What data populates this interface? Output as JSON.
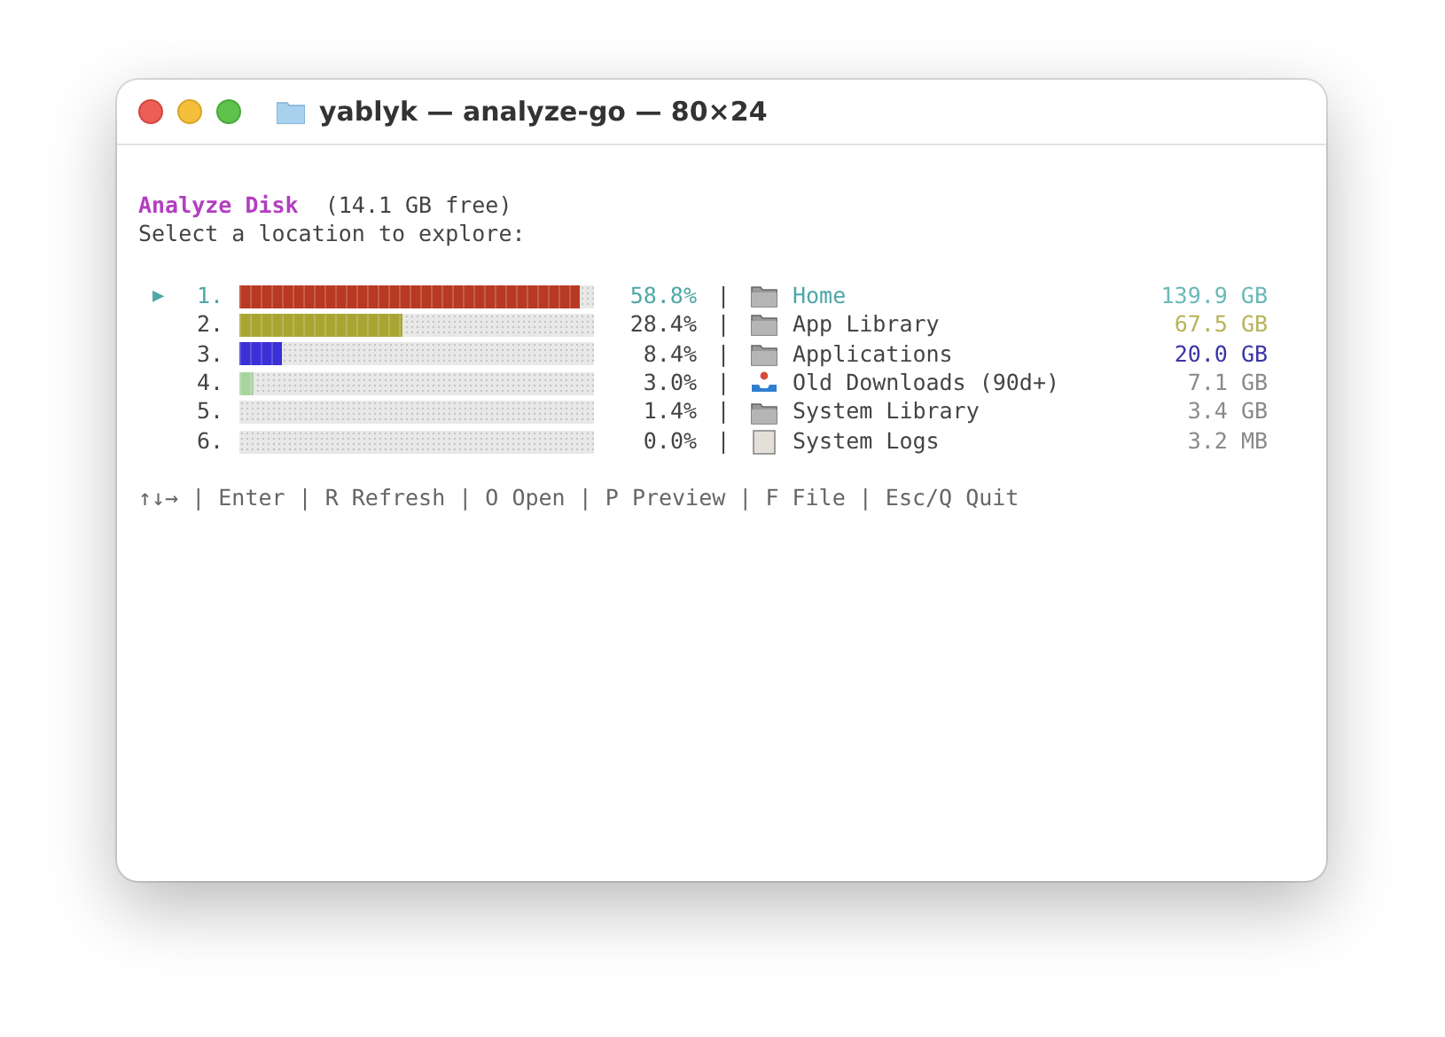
{
  "window": {
    "title": "yablyk — analyze-go — 80×24"
  },
  "header": {
    "title": "Analyze Disk",
    "free": "(14.1 GB free)",
    "prompt": "Select a location to explore:"
  },
  "pointer": "▶",
  "separator": "|",
  "rows": [
    {
      "number": "1.",
      "bar": {
        "level": 0.96,
        "color": "#b83a22"
      },
      "percent": "58.8%",
      "kind": "folder",
      "name": "Home",
      "size": {
        "text": "139.9 GB",
        "color": "#6bb8b8"
      },
      "selected": true
    },
    {
      "number": "2.",
      "bar": {
        "level": 0.46,
        "color": "#a8a533"
      },
      "percent": "28.4%",
      "kind": "folder",
      "name": "App Library",
      "size": {
        "text": "67.5 GB",
        "color": "#b8b35a"
      },
      "selected": false
    },
    {
      "number": "3.",
      "bar": {
        "level": 0.12,
        "color": "#3b2fd6"
      },
      "percent": "8.4%",
      "kind": "folder",
      "name": "Applications",
      "size": {
        "text": "20.0 GB",
        "color": "#3a34a8"
      },
      "selected": false
    },
    {
      "number": "4.",
      "bar": {
        "level": 0.04,
        "color": "#a9d4a0"
      },
      "percent": "3.0%",
      "kind": "download",
      "name": "Old Downloads (90d+)",
      "size": {
        "text": "7.1 GB",
        "color": "#8a8a8a"
      },
      "selected": false
    },
    {
      "number": "5.",
      "percent": "1.4%",
      "kind": "folder",
      "name": "System Library",
      "size": {
        "text": "3.4 GB",
        "color": "#8a8a8a"
      },
      "selected": false
    },
    {
      "number": "6.",
      "percent": "0.0%",
      "kind": "document",
      "name": "System Logs",
      "size": {
        "text": "3.2 MB",
        "color": "#8a8a8a"
      },
      "selected": false
    }
  ],
  "footer": "↑↓→ | Enter | R Refresh | O Open | P Preview | F File | Esc/Q Quit"
}
